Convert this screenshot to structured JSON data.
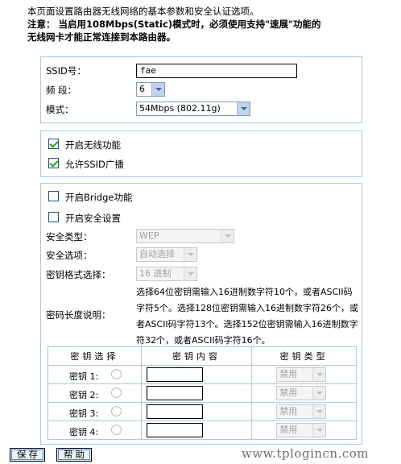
{
  "notice": {
    "line1": "本页面设置路由器无线网络的基本参数和安全认证选项。",
    "line2": "注意： 当启用108Mbps(Static)模式时，必须使用支持\"速展\"功能的",
    "line3": "无线网卡才能正常连接到本路由器。"
  },
  "basic": {
    "ssid_label": "SSID号：",
    "ssid_value": "fae",
    "channel_label": "频  段：",
    "channel_value": "6",
    "mode_label": "模式：",
    "mode_value": "54Mbps (802.11g)"
  },
  "switches": {
    "wireless_label": "开启无线功能",
    "wireless_checked": true,
    "broadcast_label": "允许SSID广播",
    "broadcast_checked": true
  },
  "security": {
    "bridge_label": "开启Bridge功能",
    "bridge_checked": false,
    "security_label": "开启安全设置",
    "security_checked": false,
    "type_label": "安全类型：",
    "type_value": "WEP",
    "option_label": "安全选项：",
    "option_value": "自动选择",
    "format_label": "密钥格式选择：",
    "format_value": "16 进制",
    "length_label": "密码长度说明：",
    "length_desc": "选择64位密钥需输入16进制数字符10个，或者ASCII码字符5个。选择128位密钥需输入16进制数字符26个，或者ASCII码字符13个。选择152位密钥需输入16进制数字符32个，或者ASCII码字符16个。"
  },
  "key_table": {
    "headers": [
      "密钥选择",
      "密钥内容",
      "密钥类型"
    ],
    "rows": [
      {
        "name": "密钥 1:",
        "value": "",
        "type": "禁用"
      },
      {
        "name": "密钥 2:",
        "value": "",
        "type": "禁用"
      },
      {
        "name": "密钥 3:",
        "value": "",
        "type": "禁用"
      },
      {
        "name": "密钥 4:",
        "value": "",
        "type": "禁用"
      }
    ]
  },
  "buttons": {
    "save": "保存",
    "help": "帮助"
  },
  "watermark": "www.tplogincn.com"
}
